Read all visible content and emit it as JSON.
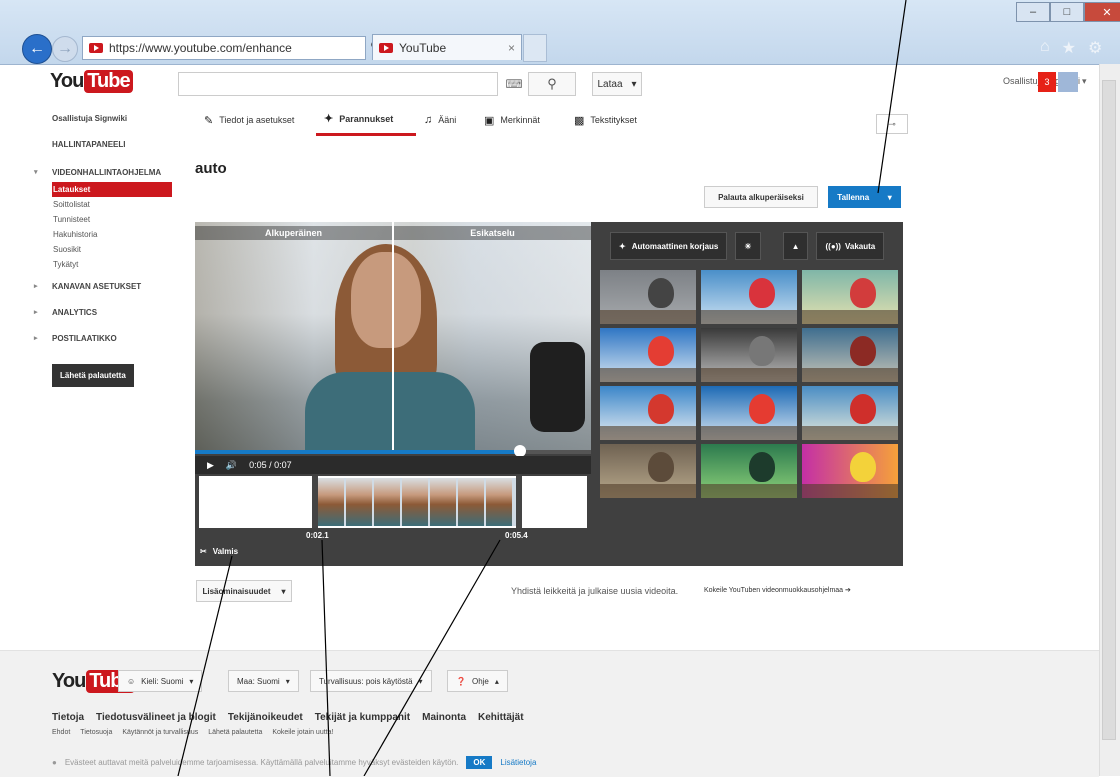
{
  "browser": {
    "url": "https://www.youtube.com/enhance",
    "tab_title": "YouTube",
    "window_controls": [
      "–",
      "□",
      "✕"
    ]
  },
  "header": {
    "logo_you": "You",
    "logo_tube": "Tube",
    "upload_label": "Lataa",
    "user_name": "Osallistuja Signwiki",
    "notif_count": "3"
  },
  "sidebar": {
    "user": "Osallistuja Signwiki",
    "dashboard": "HALLINTAPANEELI",
    "video_manager": "VIDEONHALLINTAOHJELMA",
    "items": [
      "Lataukset",
      "Soittolistat",
      "Tunnisteet",
      "Hakuhistoria",
      "Suosikit",
      "Tykätyt"
    ],
    "channel_settings": "KANAVAN ASETUKSET",
    "analytics": "ANALYTICS",
    "inbox": "POSTILAATIKKO",
    "feedback": "Lähetä palautetta"
  },
  "tabs": [
    "Tiedot ja asetukset",
    "Parannukset",
    "Ääni",
    "Merkinnät",
    "Tekstitykset"
  ],
  "editor": {
    "title": "auto",
    "revert_label": "Palauta alkuperäiseksi",
    "save_label": "Tallenna",
    "original_label": "Alkuperäinen",
    "preview_label": "Esikatselu",
    "time": "0:05 / 0:07",
    "trim_start": "0:02.1",
    "trim_end": "0:05.4",
    "trim_label": "Valmis",
    "progress": 0.82,
    "auto_fix": "Automaattinen korjaus",
    "stabilize": "Vakauta"
  },
  "below": {
    "extra_features": "Lisäominaisuudet",
    "combine_text": "Yhdistä leikkeitä ja julkaise uusia videoita.",
    "try_editor": "Kokeile YouTuben videonmuokkausohjelmaa"
  },
  "footer": {
    "language": "Kieli: Suomi",
    "country": "Maa: Suomi",
    "safety": "Turvallisuus: pois käytöstä",
    "help": "Ohje",
    "links": [
      "Tietoja",
      "Tiedotusvälineet ja blogit",
      "Tekijänoikeudet",
      "Tekijät ja kumppanit",
      "Mainonta",
      "Kehittäjät"
    ],
    "links2": [
      "Ehdot",
      "Tietosuoja",
      "Käytännöt ja turvallisuus",
      "Lähetä palautetta",
      "Kokeile jotain uutta!"
    ],
    "cookie_text": "Evästeet auttavat meitä palveluidemme tarjoamisessa. Käyttämällä palveluitamme hyväksyt evästeiden käytön.",
    "ok": "OK",
    "more_info": "Lisätietoja"
  },
  "colors": {
    "brand": "#cc181e",
    "accent": "#167ac6"
  }
}
